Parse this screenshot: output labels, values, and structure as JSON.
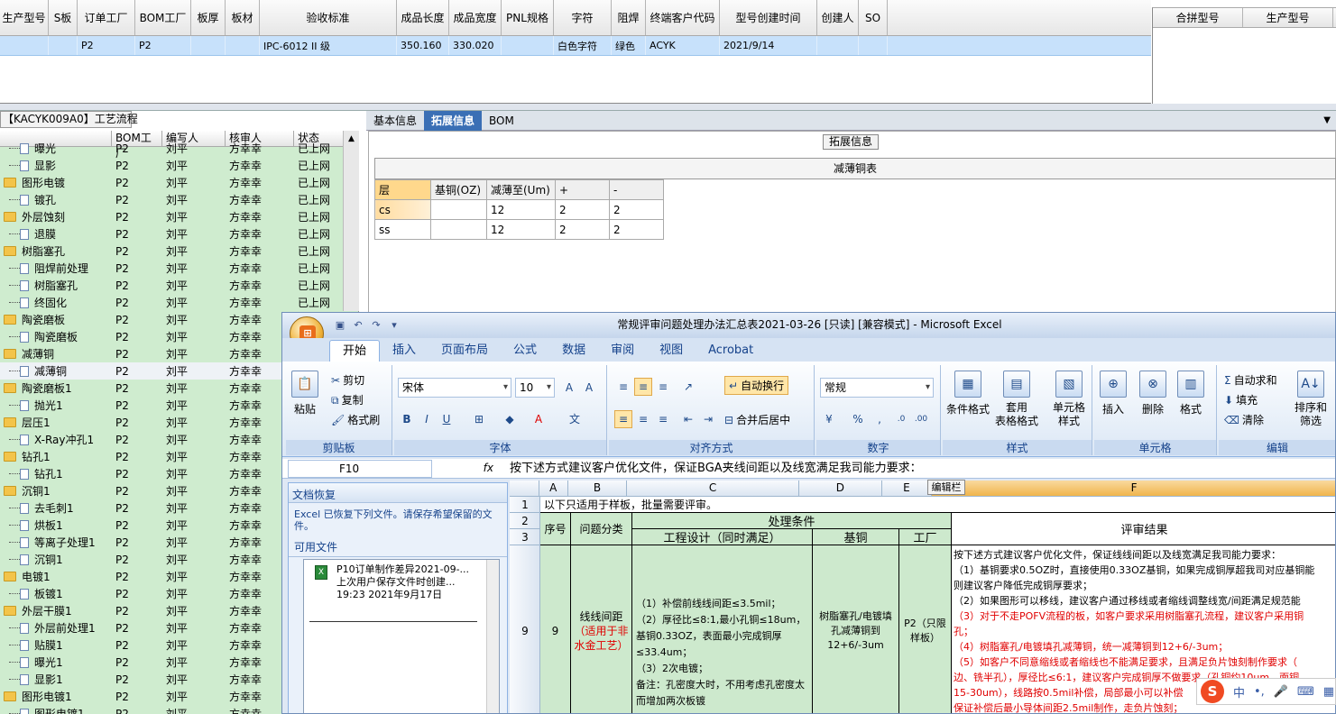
{
  "top_grid": {
    "headers": [
      "生产型号",
      "S板",
      "订单工厂",
      "BOM工厂",
      "板厚",
      "板材",
      "验收标准",
      "成品长度",
      "成品宽度",
      "PNL规格",
      "字符",
      "阻焊",
      "终端客户代码",
      "型号创建时间",
      "创建人",
      "SO"
    ],
    "row": [
      "",
      "",
      "P2",
      "P2",
      "",
      "",
      "IPC-6012 II 级",
      "350.160",
      "330.020",
      "",
      "白色字符",
      "绿色",
      "ACYK",
      "2021/9/14",
      "",
      ""
    ]
  },
  "right_grid": {
    "headers": [
      "合拼型号",
      "生产型号"
    ]
  },
  "left_panel": {
    "tab_label": "【KACYK009A0】工艺流程",
    "columns": [
      "BOM工厂",
      "编写人",
      "核审人",
      "状态"
    ],
    "rows": [
      {
        "name": "曝光",
        "type": "doc",
        "bom": "P2",
        "writer": "刘平",
        "reviewer": "方幸幸",
        "status": "已上网"
      },
      {
        "name": "显影",
        "type": "doc",
        "bom": "P2",
        "writer": "刘平",
        "reviewer": "方幸幸",
        "status": "已上网"
      },
      {
        "name": "图形电镀",
        "type": "folder",
        "bom": "P2",
        "writer": "刘平",
        "reviewer": "方幸幸",
        "status": "已上网"
      },
      {
        "name": "镀孔",
        "type": "doc",
        "bom": "P2",
        "writer": "刘平",
        "reviewer": "方幸幸",
        "status": "已上网"
      },
      {
        "name": "外层蚀刻",
        "type": "folder",
        "bom": "P2",
        "writer": "刘平",
        "reviewer": "方幸幸",
        "status": "已上网"
      },
      {
        "name": "退膜",
        "type": "doc",
        "bom": "P2",
        "writer": "刘平",
        "reviewer": "方幸幸",
        "status": "已上网"
      },
      {
        "name": "树脂塞孔",
        "type": "folder",
        "bom": "P2",
        "writer": "刘平",
        "reviewer": "方幸幸",
        "status": "已上网"
      },
      {
        "name": "阻焊前处理",
        "type": "doc",
        "bom": "P2",
        "writer": "刘平",
        "reviewer": "方幸幸",
        "status": "已上网"
      },
      {
        "name": "树脂塞孔",
        "type": "doc",
        "bom": "P2",
        "writer": "刘平",
        "reviewer": "方幸幸",
        "status": "已上网"
      },
      {
        "name": "终固化",
        "type": "doc",
        "bom": "P2",
        "writer": "刘平",
        "reviewer": "方幸幸",
        "status": "已上网"
      },
      {
        "name": "陶瓷磨板",
        "type": "folder",
        "bom": "P2",
        "writer": "刘平",
        "reviewer": "方幸幸",
        "status": ""
      },
      {
        "name": "陶瓷磨板",
        "type": "doc",
        "bom": "P2",
        "writer": "刘平",
        "reviewer": "方幸幸",
        "status": ""
      },
      {
        "name": "减薄铜",
        "type": "folder",
        "bom": "P2",
        "writer": "刘平",
        "reviewer": "方幸幸",
        "status": ""
      },
      {
        "name": "减薄铜",
        "type": "doc",
        "bom": "P2",
        "writer": "刘平",
        "reviewer": "方幸幸",
        "status": "",
        "selected": true
      },
      {
        "name": "陶瓷磨板1",
        "type": "folder",
        "bom": "P2",
        "writer": "刘平",
        "reviewer": "方幸幸",
        "status": ""
      },
      {
        "name": "抛光1",
        "type": "doc",
        "bom": "P2",
        "writer": "刘平",
        "reviewer": "方幸幸",
        "status": ""
      },
      {
        "name": "层压1",
        "type": "folder",
        "bom": "P2",
        "writer": "刘平",
        "reviewer": "方幸幸",
        "status": ""
      },
      {
        "name": "X-Ray冲孔1",
        "type": "doc",
        "bom": "P2",
        "writer": "刘平",
        "reviewer": "方幸幸",
        "status": ""
      },
      {
        "name": "钻孔1",
        "type": "folder",
        "bom": "P2",
        "writer": "刘平",
        "reviewer": "方幸幸",
        "status": ""
      },
      {
        "name": "钻孔1",
        "type": "doc",
        "bom": "P2",
        "writer": "刘平",
        "reviewer": "方幸幸",
        "status": ""
      },
      {
        "name": "沉铜1",
        "type": "folder",
        "bom": "P2",
        "writer": "刘平",
        "reviewer": "方幸幸",
        "status": ""
      },
      {
        "name": "去毛刺1",
        "type": "doc",
        "bom": "P2",
        "writer": "刘平",
        "reviewer": "方幸幸",
        "status": ""
      },
      {
        "name": "烘板1",
        "type": "doc",
        "bom": "P2",
        "writer": "刘平",
        "reviewer": "方幸幸",
        "status": ""
      },
      {
        "name": "等离子处理1",
        "type": "doc",
        "bom": "P2",
        "writer": "刘平",
        "reviewer": "方幸幸",
        "status": ""
      },
      {
        "name": "沉铜1",
        "type": "doc",
        "bom": "P2",
        "writer": "刘平",
        "reviewer": "方幸幸",
        "status": ""
      },
      {
        "name": "电镀1",
        "type": "folder",
        "bom": "P2",
        "writer": "刘平",
        "reviewer": "方幸幸",
        "status": ""
      },
      {
        "name": "板镀1",
        "type": "doc",
        "bom": "P2",
        "writer": "刘平",
        "reviewer": "方幸幸",
        "status": ""
      },
      {
        "name": "外层干膜1",
        "type": "folder",
        "bom": "P2",
        "writer": "刘平",
        "reviewer": "方幸幸",
        "status": ""
      },
      {
        "name": "外层前处理1",
        "type": "doc",
        "bom": "P2",
        "writer": "刘平",
        "reviewer": "方幸幸",
        "status": ""
      },
      {
        "name": "贴膜1",
        "type": "doc",
        "bom": "P2",
        "writer": "刘平",
        "reviewer": "方幸幸",
        "status": ""
      },
      {
        "name": "曝光1",
        "type": "doc",
        "bom": "P2",
        "writer": "刘平",
        "reviewer": "方幸幸",
        "status": ""
      },
      {
        "name": "显影1",
        "type": "doc",
        "bom": "P2",
        "writer": "刘平",
        "reviewer": "方幸幸",
        "status": ""
      },
      {
        "name": "图形电镀1",
        "type": "folder",
        "bom": "P2",
        "writer": "刘平",
        "reviewer": "方幸幸",
        "status": ""
      },
      {
        "name": "图形电镀1",
        "type": "doc",
        "bom": "P2",
        "writer": "刘平",
        "reviewer": "方幸幸",
        "status": ""
      }
    ]
  },
  "right_tabs": [
    "基本信息",
    "拓展信息",
    "BOM"
  ],
  "ext_panel": {
    "label": "拓展信息",
    "table_title": "减薄铜表",
    "headers": [
      "层",
      "基铜(OZ)",
      "减薄至(Um)",
      "+",
      "-"
    ],
    "rows": [
      [
        "cs",
        "",
        "12",
        "2",
        "2"
      ],
      [
        "ss",
        "",
        "12",
        "2",
        "2"
      ]
    ]
  },
  "excel": {
    "title": "常规评审问题处理办法汇总表2021-03-26 [只读] [兼容模式] - Microsoft Excel",
    "tabs": [
      "开始",
      "插入",
      "页面布局",
      "公式",
      "数据",
      "审阅",
      "视图",
      "Acrobat"
    ],
    "clipboard": {
      "paste": "粘贴",
      "cut": "剪切",
      "copy": "复制",
      "format_painter": "格式刷",
      "label": "剪贴板"
    },
    "font": {
      "name": "宋体",
      "size": "10",
      "label": "字体"
    },
    "align": {
      "wrap": "自动换行",
      "merge": "合并后居中",
      "label": "对齐方式"
    },
    "number": {
      "format": "常规",
      "label": "数字"
    },
    "styles": {
      "cond": "条件格式",
      "table": "套用\n表格格式",
      "cell": "单元格\n样式",
      "label": "样式"
    },
    "cells": {
      "insert": "插入",
      "delete": "删除",
      "format": "格式",
      "label": "单元格"
    },
    "edit": {
      "sum": "自动求和",
      "fill": "填充",
      "clear": "清除",
      "sort": "排序和\n筛选",
      "label": "编辑"
    },
    "name_box": "F10",
    "formula": "按下述方式建议客户优化文件，保证BGA夹线间距以及线宽满足我司能力要求：",
    "edit_bar_label": "编辑栏",
    "recovery": {
      "title": "文档恢复",
      "desc": "Excel 已恢复下列文件。请保存希望保留的文件。",
      "avail": "可用文件",
      "file_name": "P10订单制作差异2021-09-...",
      "file_desc": "上次用户保存文件时创建...",
      "file_time": "19:23 2021年9月17日"
    },
    "sheet": {
      "cols": [
        "A",
        "B",
        "C",
        "D",
        "E",
        "F"
      ],
      "rows": [
        "1",
        "2",
        "3",
        "9"
      ],
      "r1": "以下只适用于样板，批量需要评审。",
      "seq": "序号",
      "cat": "问题分类",
      "cond": "处理条件",
      "eng": "工程设计（同时满足）",
      "base": "基铜",
      "factory": "工厂",
      "result": "评审结果",
      "r9_seq": "9",
      "r9_cat": "线线间距",
      "r9_cat_red": "（适用于非水金工艺）",
      "r9_eng": "（1）补偿前线线间距≤3.5mil；\n（2）厚径比≤8:1,最小孔铜≤18um，基铜0.33OZ，表面最小完成铜厚≤33.4um；\n（3）2次电镀；\n备注：孔密度大时，不用考虑孔密度太而增加两次板镀",
      "r9_base": "树脂塞孔/电镀填孔减薄铜到12+6/-3um",
      "r9_factory": "P2（只限样板）",
      "r9_result": [
        {
          "t": "按下述方式建议客户优化文件，保证线线间距以及线宽满足我司能力要求：",
          "red": false
        },
        {
          "t": "（1）基铜要求0.5OZ时，直接使用0.33OZ基铜，如果完成铜厚超我司对应基铜能",
          "red": false
        },
        {
          "t": "则建议客户降低完成铜厚要求；",
          "red": false
        },
        {
          "t": "（2）如果图形可以移线，建议客户通过移线或者缩线调整线宽/间距满足规范能",
          "red": false
        },
        {
          "t": "（3）对于不走POFV流程的板，如客户要求采用树脂塞孔流程，建议客户采用铜",
          "red": true
        },
        {
          "t": "孔；",
          "red": true
        },
        {
          "t": "（4）树脂塞孔/电镀填孔减薄铜，统一减薄铜到12+6/-3um；",
          "red": true
        },
        {
          "t": "（5）如客户不同意缩线或者缩线也不能满足要求，且满足负片蚀刻制作要求（",
          "red": true
        },
        {
          "t": "边、铣半孔），厚径比≤6:1，建议客户完成铜厚不做要求（孔铜约10um，面铜",
          "red": true
        },
        {
          "t": "15-30um），线路按0.5mil补偿，局部最小可以补偿",
          "red": true
        },
        {
          "t": "保证补偿后最小导体间距2.5mil制作，走负片蚀刻；",
          "red": true
        }
      ]
    }
  },
  "ime": {
    "logo": "S",
    "lang": "中"
  }
}
